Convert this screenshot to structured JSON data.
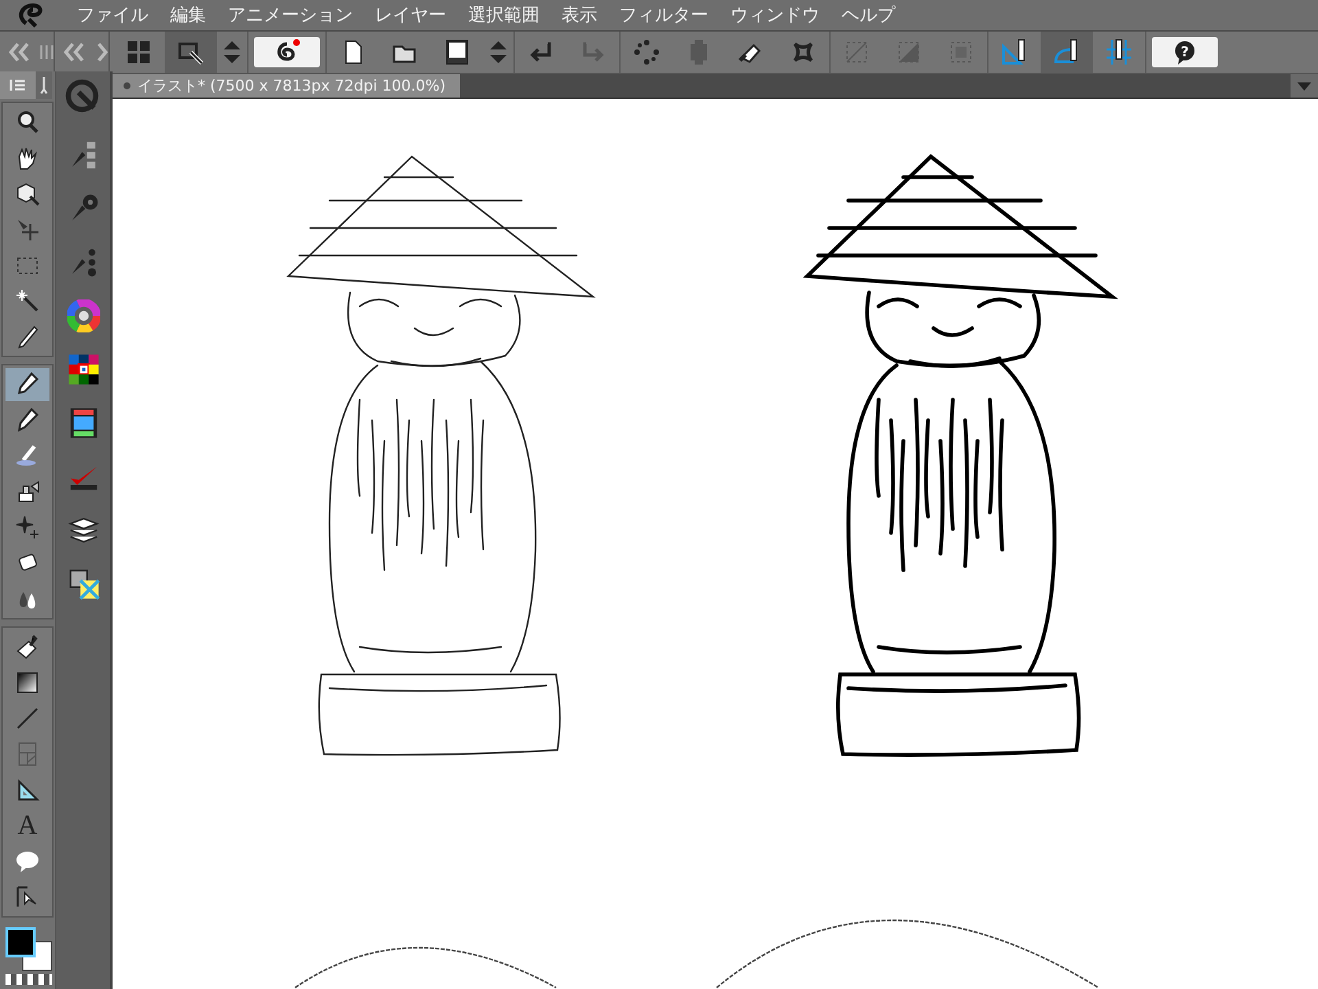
{
  "menu": [
    "ファイル",
    "編集",
    "アニメーション",
    "レイヤー",
    "選択範囲",
    "表示",
    "フィルター",
    "ウィンドウ",
    "ヘルプ"
  ],
  "toolbar": [
    {
      "selected": false,
      "disabled": false
    },
    {
      "selected": true,
      "disabled": false
    },
    {
      "selected": false,
      "disabled": false
    },
    {
      "selected": false,
      "disabled": false
    },
    {
      "selected": false,
      "disabled": false
    },
    {
      "selected": false,
      "disabled": false
    },
    {
      "selected": false,
      "disabled": false
    },
    {
      "selected": false,
      "disabled": false
    },
    {
      "selected": false,
      "disabled": false
    },
    {
      "selected": false,
      "disabled": true
    },
    {
      "selected": false,
      "disabled": false
    },
    {
      "selected": false,
      "disabled": true
    },
    {
      "selected": false,
      "disabled": false
    },
    {
      "selected": false,
      "disabled": false
    },
    {
      "selected": false,
      "disabled": true
    },
    {
      "selected": false,
      "disabled": true
    },
    {
      "selected": false,
      "disabled": true
    },
    {
      "selected": false,
      "disabled": false
    },
    {
      "selected": true,
      "disabled": false
    },
    {
      "selected": false,
      "disabled": false
    },
    {
      "selected": false,
      "disabled": false
    }
  ],
  "help_label": "?",
  "document_tab": {
    "title": "イラスト* (7500 x 7813px 72dpi 100.0%)",
    "selected": true
  },
  "tool_groups": [
    [
      {
        "kind": "icon",
        "selected": false
      },
      {
        "kind": "icon",
        "selected": false
      },
      {
        "kind": "icon",
        "selected": false
      },
      {
        "kind": "icon",
        "selected": false
      },
      {
        "kind": "icon",
        "selected": false
      },
      {
        "kind": "icon",
        "selected": false
      },
      {
        "kind": "icon",
        "selected": false
      }
    ],
    [
      {
        "kind": "icon",
        "selected": true
      },
      {
        "kind": "icon",
        "selected": false
      },
      {
        "kind": "icon",
        "selected": false
      },
      {
        "kind": "icon",
        "selected": false
      },
      {
        "kind": "icon",
        "selected": false
      },
      {
        "kind": "icon",
        "selected": false
      },
      {
        "kind": "icon",
        "selected": false
      }
    ],
    [
      {
        "kind": "icon",
        "selected": false
      },
      {
        "kind": "icon",
        "selected": false
      },
      {
        "kind": "icon",
        "selected": false
      },
      {
        "kind": "icon",
        "selected": false
      },
      {
        "kind": "icon",
        "selected": false
      },
      {
        "kind": "glyph",
        "label": "A",
        "selected": false
      },
      {
        "kind": "icon",
        "selected": false
      },
      {
        "kind": "icon",
        "selected": false
      }
    ]
  ]
}
